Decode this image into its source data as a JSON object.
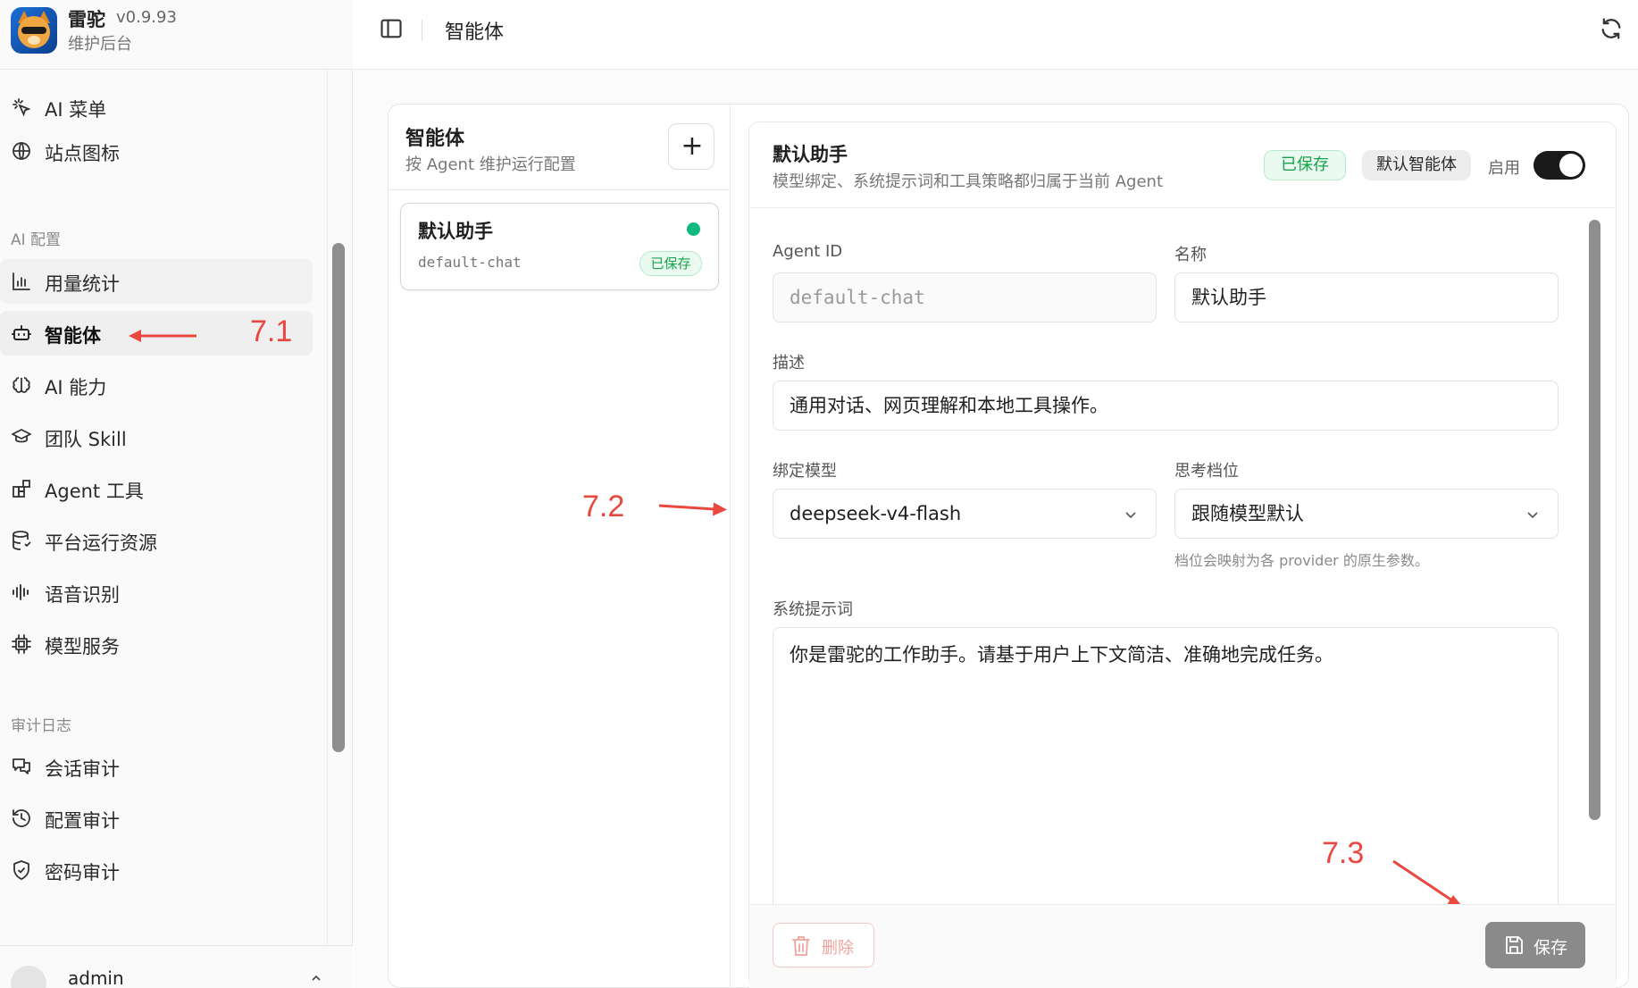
{
  "brand": {
    "name": "雷驼",
    "version": "v0.9.93",
    "subtitle": "维护后台"
  },
  "sidebar": {
    "top_items": [
      {
        "label": "AI 菜单",
        "icon": "sparkle-pointer-icon"
      },
      {
        "label": "站点图标",
        "icon": "globe-icon"
      }
    ],
    "section_ai": "AI 配置",
    "ai_items": [
      {
        "label": "用量统计",
        "icon": "bar-chart-icon"
      },
      {
        "label": "智能体",
        "icon": "robot-icon",
        "active": true
      },
      {
        "label": "AI 能力",
        "icon": "brain-icon"
      },
      {
        "label": "团队 Skill",
        "icon": "graduation-cap-icon"
      },
      {
        "label": "Agent 工具",
        "icon": "blocks-icon"
      },
      {
        "label": "平台运行资源",
        "icon": "database-icon"
      },
      {
        "label": "语音识别",
        "icon": "audio-wave-icon"
      },
      {
        "label": "模型服务",
        "icon": "chip-icon"
      }
    ],
    "section_audit": "审计日志",
    "audit_items": [
      {
        "label": "会话审计",
        "icon": "chat-bubbles-icon"
      },
      {
        "label": "配置审计",
        "icon": "history-icon"
      },
      {
        "label": "密码审计",
        "icon": "shield-check-icon"
      }
    ],
    "user": {
      "name": "admin"
    }
  },
  "header": {
    "title": "智能体"
  },
  "annotations": {
    "a1": "7.1",
    "a2": "7.2",
    "a3": "7.3"
  },
  "list": {
    "title": "智能体",
    "subtitle": "按 Agent 维护运行配置",
    "add_label": "+",
    "items": [
      {
        "name": "默认助手",
        "id": "default-chat",
        "badge": "已保存",
        "status_color": "#10b981"
      }
    ]
  },
  "detail": {
    "title": "默认助手",
    "subtitle": "模型绑定、系统提示词和工具策略都归属于当前 Agent",
    "saved_badge": "已保存",
    "default_badge": "默认智能体",
    "enable_label": "启用",
    "enabled": true,
    "fields": {
      "agent_id_label": "Agent ID",
      "agent_id_value": "default-chat",
      "name_label": "名称",
      "name_value": "默认助手",
      "desc_label": "描述",
      "desc_value": "通用对话、网页理解和本地工具操作。",
      "model_label": "绑定模型",
      "model_value": "deepseek-v4-flash",
      "think_label": "思考档位",
      "think_value": "跟随模型默认",
      "think_hint": "档位会映射为各 provider 的原生参数。",
      "prompt_label": "系统提示词",
      "prompt_value": "你是雷驼的工作助手。请基于用户上下文简洁、准确地完成任务。"
    },
    "delete_label": "删除",
    "save_label": "保存"
  },
  "colors": {
    "accent_green": "#16a34a",
    "status_dot": "#10b981",
    "annotation_red": "#e9483f"
  }
}
